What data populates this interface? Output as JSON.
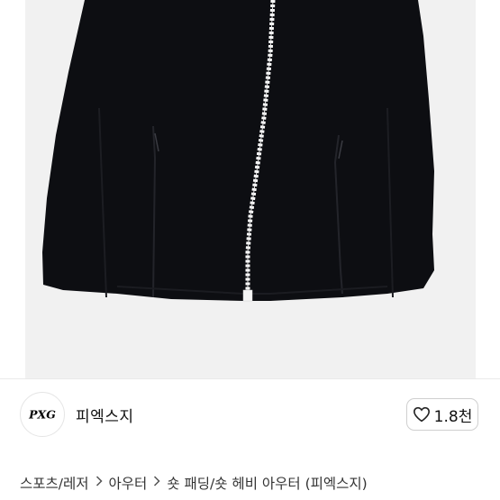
{
  "product_image": {
    "alt": "black zip-up jacket"
  },
  "seller": {
    "logo_text": "PXG",
    "name": "피엑스지"
  },
  "like": {
    "count": "1.8천",
    "icon": "heart-outline-icon"
  },
  "breadcrumb": {
    "items": [
      {
        "label": "스포츠/레저"
      },
      {
        "label": "아우터"
      },
      {
        "label": "숏 패딩/숏 헤비 아우터 (피엑스지)"
      }
    ],
    "separator_icon": "chevron-right-icon"
  },
  "colors": {
    "jacket": "#0d0e12",
    "zipper": "#ffffff",
    "photo_background": "#f1f1f1",
    "text": "#111111"
  }
}
